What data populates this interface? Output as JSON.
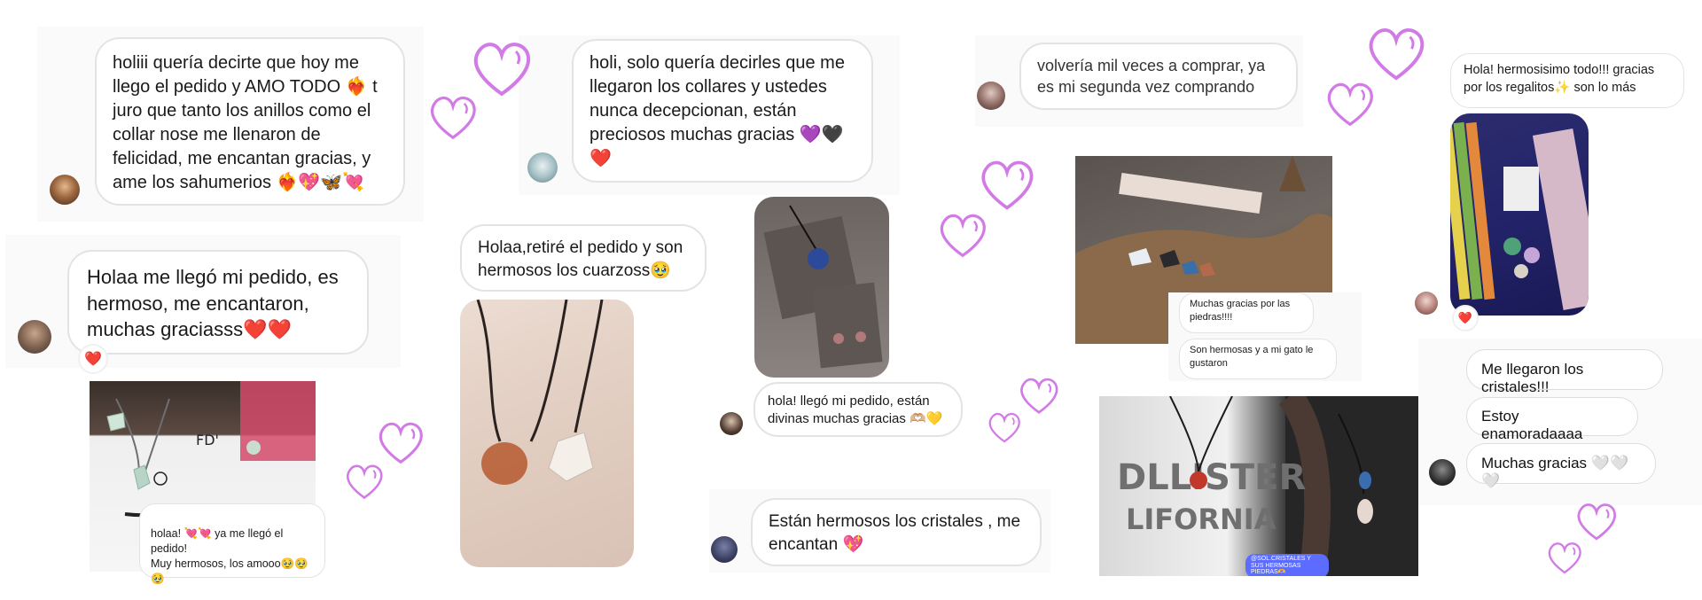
{
  "colors": {
    "heart": "#d27be6",
    "bubble_border": "#e3e3e3",
    "react_red": "#e0202a"
  },
  "reviews": {
    "r1": {
      "text": "holiii quería decirte que hoy me llego el pedido y AMO TODO ❤️‍🔥 t juro que tanto los anillos como el collar nose me llenaron de felicidad, me encantan gracias, y ame los sahumerios ❤️‍🔥💖🦋💘"
    },
    "r2": {
      "text": "Holaa me llegó mi pedido, es hermoso, me encantaron, muchas graciasss❤️❤️",
      "reaction": "❤️"
    },
    "r3": {
      "caption": "holaa! 💘💘 ya me llegó el pedido!\nMuy hermosos, los amooo🥹🥹🥹"
    },
    "r4": {
      "text": "holi, solo quería decirles que me llegaron los collares y ustedes nunca decepcionan, están preciosos muchas gracias 💜🖤❤️"
    },
    "r5": {
      "text": "Holaa,retiré el pedido y son hermosos los cuarzoss🥹"
    },
    "r6": {
      "text": "hola! llegó mi pedido, están divinas muchas gracias 🫶🏼💛"
    },
    "r7": {
      "text": "Están hermosos los cristales , me encantan 💖"
    },
    "r8": {
      "text": "volvería mil veces a comprar, ya es mi segunda vez comprando"
    },
    "r9": {
      "line1": "Muchas gracias por las piedras!!!!",
      "line2": "Son hermosas y a mi gato le gustaron"
    },
    "r10": {
      "tag": "@SOL.CRISTALES Y SUS HERMOSAS PIEDRAS🫶"
    },
    "r11": {
      "text": "Hola! hermosisimo todo!!! gracias por los regalitos✨ son lo más",
      "reaction": "❤️"
    },
    "r12": {
      "line1": "Me llegaron los cristales!!!",
      "line2": "Estoy enamoradaaaa",
      "line3": "Muchas gracias 🤍🤍🤍"
    }
  }
}
